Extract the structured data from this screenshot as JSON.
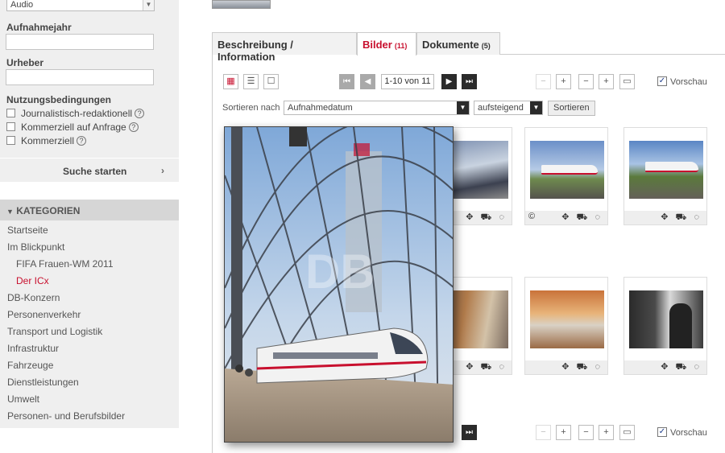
{
  "filter": {
    "media_type_value": "Audio",
    "year_label": "Aufnahmejahr",
    "year_value": "",
    "author_label": "Urheber",
    "author_value": "",
    "usage_label": "Nutzungsbedingungen",
    "usage_options": [
      {
        "label": "Journalistisch-redaktionell",
        "help": "?"
      },
      {
        "label": "Kommerziell auf Anfrage",
        "help": "?"
      },
      {
        "label": "Kommerziell",
        "help": "?"
      }
    ],
    "search_button": "Suche starten",
    "search_arrow": "›"
  },
  "categories": {
    "title": "KATEGORIEN",
    "items": [
      {
        "label": "Startseite"
      },
      {
        "label": "Im Blickpunkt"
      },
      {
        "label": "FIFA Frauen-WM 2011"
      },
      {
        "label": "Der ICx"
      },
      {
        "label": "DB-Konzern"
      },
      {
        "label": "Personenverkehr"
      },
      {
        "label": "Transport und Logistik"
      },
      {
        "label": "Infrastruktur"
      },
      {
        "label": "Fahrzeuge"
      },
      {
        "label": "Dienstleistungen"
      },
      {
        "label": "Umwelt"
      },
      {
        "label": "Personen- und Berufsbilder"
      }
    ]
  },
  "tabs": [
    {
      "label": "Beschreibung / Information",
      "count": ""
    },
    {
      "label": "Bilder",
      "count": "(11)"
    },
    {
      "label": "Dokumente",
      "count": "(5)"
    }
  ],
  "toolbar": {
    "pager_text": "1-10 von 11",
    "preview_label": "Vorschau",
    "sort_by_label": "Sortieren nach",
    "sort_field_value": "Aufnahmedatum",
    "sort_order_value": "aufsteigend",
    "sort_button": "Sortieren",
    "view_icons": {
      "grid": "▦",
      "list": "☰",
      "single": "☐"
    },
    "nav_icons": {
      "first": "⏮",
      "prev": "◀",
      "next": "▶",
      "last": "⏭"
    },
    "zoom_icons": {
      "zoom_out": "−",
      "zoom_in": "+",
      "minus": "−",
      "plus": "+",
      "screen": "▭"
    },
    "preview_checked": "✓"
  },
  "thumbnails": {
    "action_icons": "✥ ⛟ ◌",
    "copyright": "©"
  },
  "colors": {
    "accent": "#c8102e",
    "sidebar_bg": "#efefef"
  }
}
